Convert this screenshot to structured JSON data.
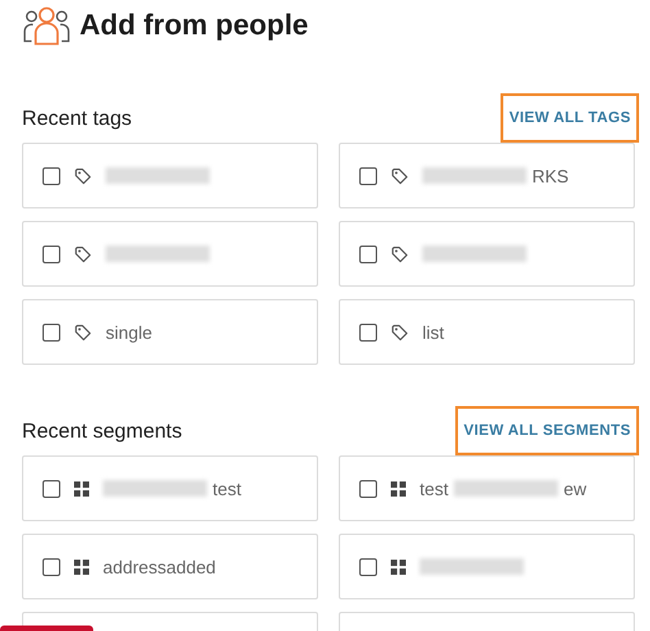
{
  "title": "Add from people",
  "sections": [
    {
      "kind": "tag",
      "heading": "Recent tags",
      "link": {
        "label": "VIEW ALL TAGS",
        "highlighted": true
      },
      "more_below": false,
      "items": [
        {
          "checked": false,
          "parts": [
            {
              "kind": "redacted"
            }
          ]
        },
        {
          "checked": false,
          "parts": [
            {
              "kind": "redacted"
            },
            {
              "kind": "text",
              "text": "RKS"
            }
          ]
        },
        {
          "checked": false,
          "parts": [
            {
              "kind": "redacted"
            }
          ]
        },
        {
          "checked": false,
          "parts": [
            {
              "kind": "redacted"
            }
          ]
        },
        {
          "checked": false,
          "parts": [
            {
              "kind": "text",
              "text": "single"
            }
          ]
        },
        {
          "checked": false,
          "parts": [
            {
              "kind": "text",
              "text": "list"
            }
          ]
        }
      ]
    },
    {
      "kind": "segment",
      "heading": "Recent segments",
      "link": {
        "label": "VIEW ALL SEGMENTS",
        "highlighted": true
      },
      "more_below": true,
      "items": [
        {
          "checked": false,
          "parts": [
            {
              "kind": "redacted"
            },
            {
              "kind": "text",
              "text": "test"
            }
          ]
        },
        {
          "checked": false,
          "parts": [
            {
              "kind": "text",
              "text": "test"
            },
            {
              "kind": "redacted"
            },
            {
              "kind": "text",
              "text": "ew"
            }
          ]
        },
        {
          "checked": false,
          "parts": [
            {
              "kind": "text",
              "text": "addressadded"
            }
          ]
        },
        {
          "checked": false,
          "parts": [
            {
              "kind": "redacted"
            }
          ]
        }
      ]
    }
  ],
  "footer_button": {
    "kind": "primary"
  }
}
